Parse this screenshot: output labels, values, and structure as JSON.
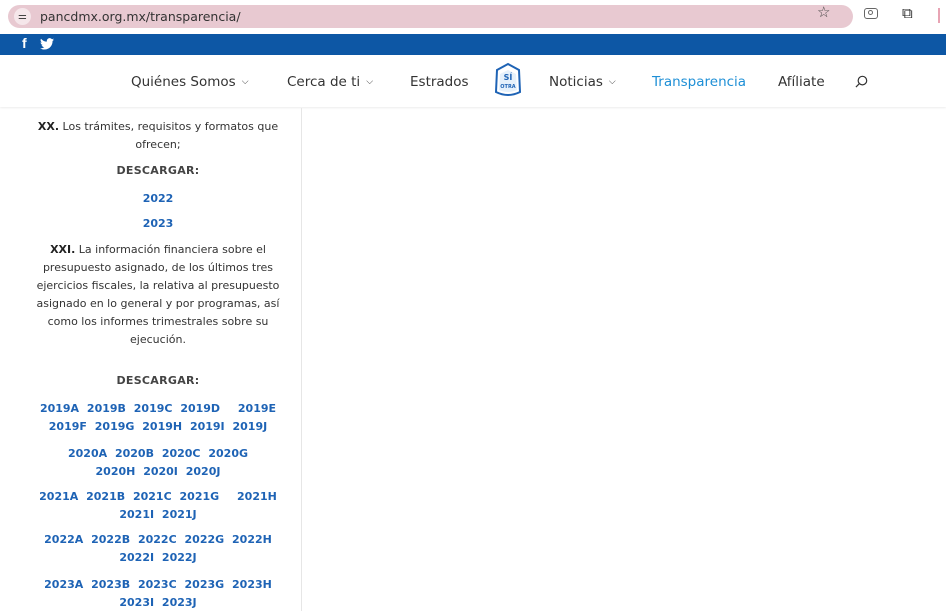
{
  "browser": {
    "url": "pancdmx.org.mx/transparencia/",
    "icons": [
      "site-settings-icon",
      "star-icon",
      "camera-icon",
      "extensions-icon"
    ]
  },
  "social": {
    "icons": [
      "facebook-icon",
      "twitter-icon"
    ],
    "facebook_glyph": "f"
  },
  "colors": {
    "social_bar": "#0d57a5",
    "url_pill": "#e8c9d1",
    "active_nav": "#1e8fd6",
    "link": "#1e63b5"
  },
  "nav": {
    "items": [
      {
        "label": "Quiénes Somos",
        "dropdown": true
      },
      {
        "label": "Cerca de ti",
        "dropdown": true
      },
      {
        "label": "Estrados",
        "dropdown": false
      },
      {
        "label": "Noticias",
        "dropdown": true
      },
      {
        "label": "Transparencia",
        "dropdown": false,
        "active": true
      },
      {
        "label": "Afíliate",
        "dropdown": false
      }
    ],
    "logo_text": [
      "SÍ",
      "OTRA"
    ],
    "chevron": "⌵"
  },
  "sidebar": {
    "xx_num": "XX.",
    "xx_text": " Los trámites, requisitos y formatos que ofrecen;",
    "download1": "DESCARGAR:",
    "years": [
      "2022",
      "2023"
    ],
    "xxi_num": "XXI.",
    "xxi_text": " La información financiera sobre el presupuesto asignado, de los últimos tres ejercicios fiscales, la relativa al presupuesto asignado en lo general y por programas, así como los informes trimestrales sobre su ejecución.",
    "download2": "DESCARGAR:",
    "groups": [
      {
        "line1": [
          "2019A",
          "2019B",
          "2019C",
          "2019D",
          "2019E"
        ],
        "line2": [
          "2019F",
          "2019G",
          "2019H",
          "2019I",
          "2019J"
        ]
      },
      {
        "line1": [
          "2020A",
          "2020B",
          "2020C",
          "2020G"
        ],
        "line2": [
          "2020H",
          "2020I",
          "2020J"
        ]
      },
      {
        "line1": [
          "2021A",
          "2021B",
          "2021C",
          "2021G",
          "2021H"
        ],
        "line2": [
          "2021I",
          "2021J"
        ]
      },
      {
        "line1": [
          "2022A",
          "2022B",
          "2022C",
          "2022G",
          "2022H"
        ],
        "line2": [
          "2022I",
          "2022J"
        ]
      },
      {
        "line1": [
          "2023A",
          "2023B",
          "2023C",
          "2023G",
          "2023H"
        ],
        "line2": [
          "2023I",
          "2023J"
        ]
      }
    ]
  }
}
